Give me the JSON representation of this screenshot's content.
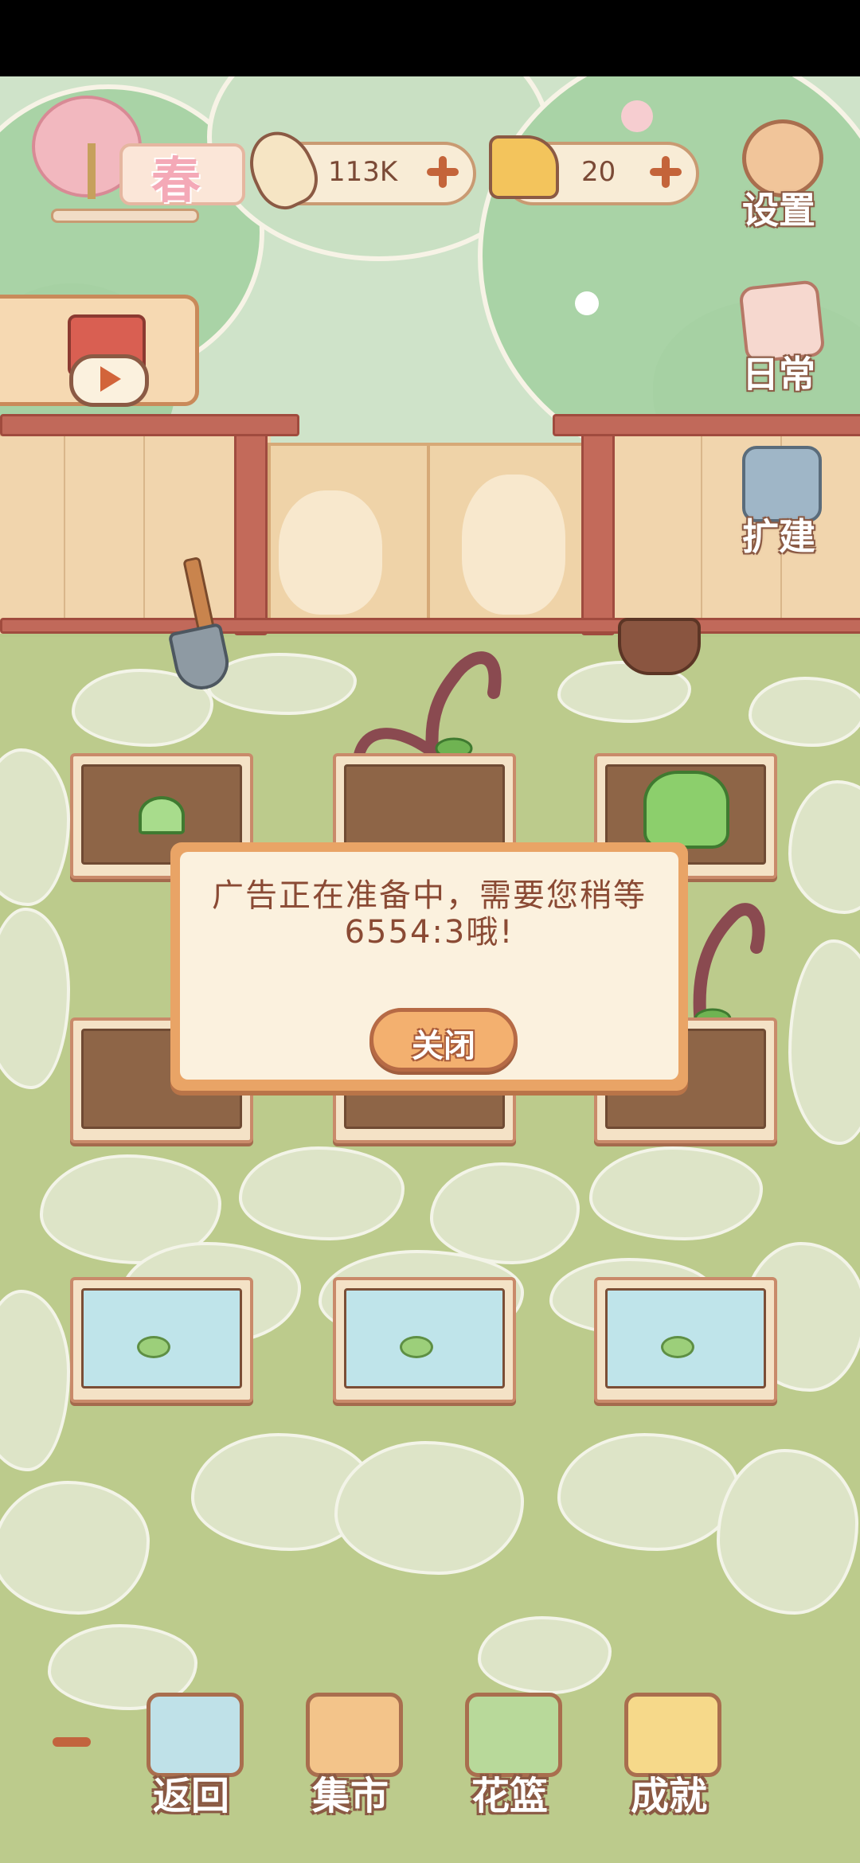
{
  "hud": {
    "season_label": "春",
    "fish_currency": "113K",
    "cheese_currency": "20"
  },
  "side_menu": {
    "settings_label": "设置",
    "daily_label": "日常",
    "expand_label": "扩建"
  },
  "dialog": {
    "message": "广告正在准备中，需要您稍等6554:3哦!",
    "close_label": "关闭"
  },
  "bottom_nav": {
    "back_label": "返回",
    "market_label": "集市",
    "basket_label": "花篮",
    "achievements_label": "成就"
  },
  "colors": {
    "accent_orange": "#e9a466",
    "text_brown": "#8a4a34",
    "grass": "#bccb8c"
  }
}
